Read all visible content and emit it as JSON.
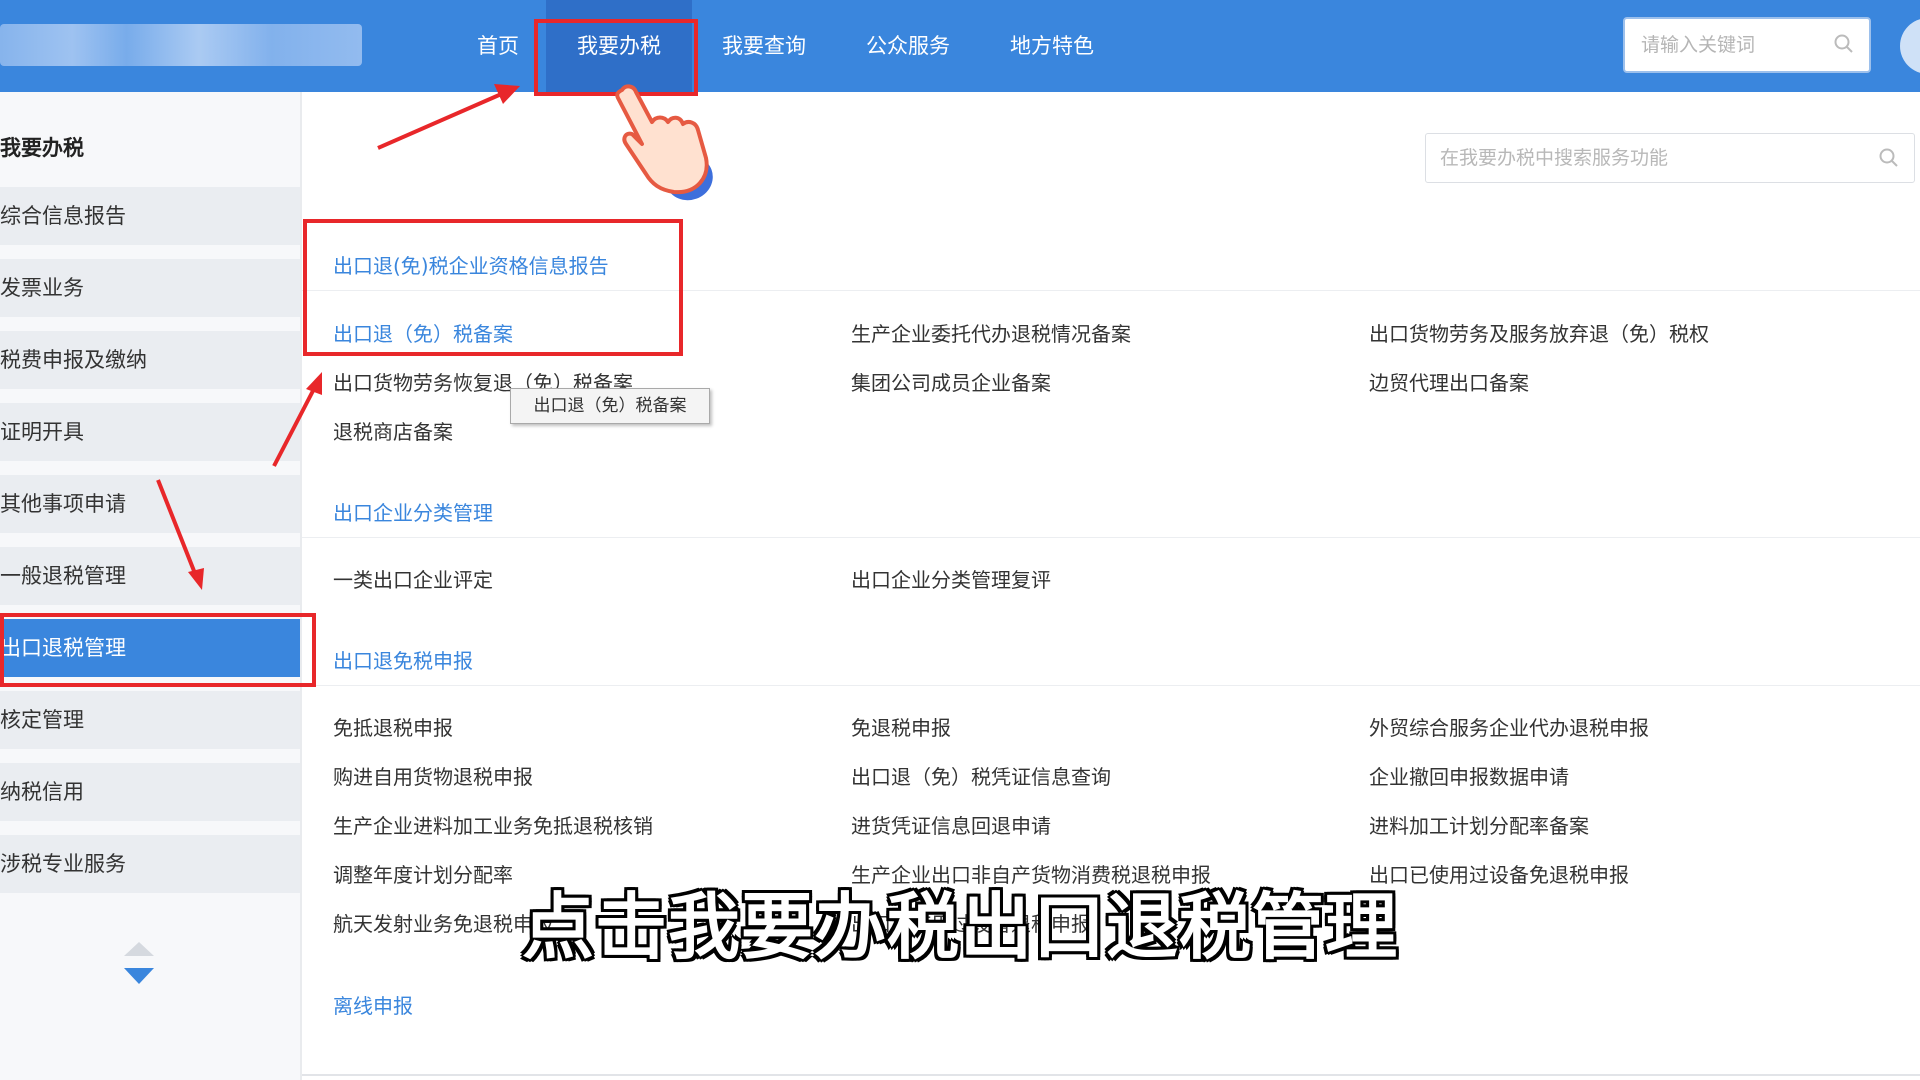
{
  "nav": {
    "items": [
      "首页",
      "我要办税",
      "我要查询",
      "公众服务",
      "地方特色"
    ],
    "search_placeholder": "请输入关键词"
  },
  "sidebar": {
    "title": "我要办税",
    "items": [
      "综合信息报告",
      "发票业务",
      "税费申报及缴纳",
      "证明开具",
      "其他事项申请",
      "一般退税管理",
      "出口退税管理",
      "核定管理",
      "纳税信用",
      "涉税专业服务"
    ],
    "active_index": 6
  },
  "main": {
    "search_placeholder": "在我要办税中搜索服务功能",
    "sections": [
      {
        "title": "出口退(免)税企业资格信息报告",
        "col1": [
          "出口退（免）税备案",
          "出口货物劳务恢复退（免）税备案",
          "退税商店备案"
        ],
        "col2": [
          "生产企业委托代办退税情况备案",
          "集团公司成员企业备案"
        ],
        "col3": [
          "出口货物劳务及服务放弃退（免）税权",
          "边贸代理出口备案"
        ]
      },
      {
        "title": "出口企业分类管理",
        "col1": [
          "一类出口企业评定"
        ],
        "col2": [
          "出口企业分类管理复评"
        ],
        "col3": []
      },
      {
        "title": "出口退免税申报",
        "col1": [
          "免抵退税申报",
          "购进自用货物退税申报",
          "生产企业进料加工业务免抵退税核销",
          "调整年度计划分配率",
          "航天发射业务免退税申报"
        ],
        "col2": [
          "免退税申报",
          "出口退（免）税凭证信息查询",
          "进货凭证信息回退申请",
          "生产企业出口非自产货物消费税退税申报",
          "出口已使用过设备退税申报"
        ],
        "col3": [
          "外贸综合服务企业代办退税申报",
          "企业撤回申报数据申请",
          "进料加工计划分配率备案",
          "出口已使用过设备免退税申报"
        ]
      },
      {
        "title": "离线申报"
      }
    ],
    "tooltip": "出口退（免）税备案"
  },
  "caption": "点击我要办税出口退税管理",
  "colors": {
    "brand": "#3a86dd",
    "annotation": "#e8272a"
  }
}
